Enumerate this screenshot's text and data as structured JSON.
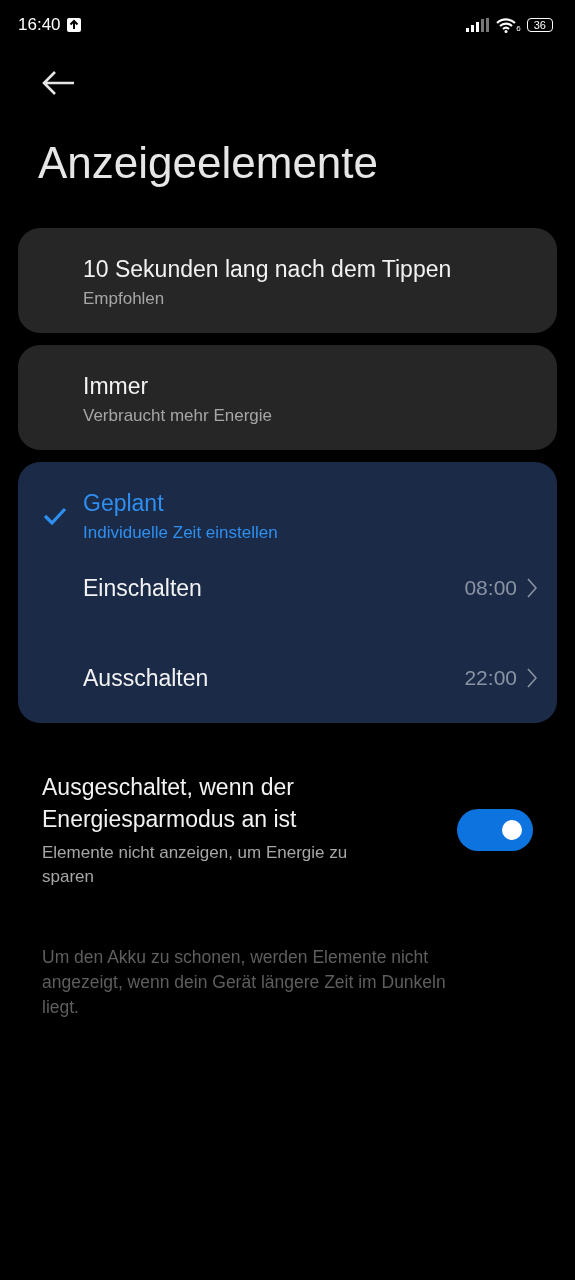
{
  "status_bar": {
    "time": "16:40",
    "wifi_badge": "6",
    "battery": "36"
  },
  "title": "Anzeigeelemente",
  "options": [
    {
      "title": "10 Sekunden lang nach dem Tippen",
      "subtitle": "Empfohlen",
      "selected": false
    },
    {
      "title": "Immer",
      "subtitle": "Verbraucht mehr Energie",
      "selected": false
    },
    {
      "title": "Geplant",
      "subtitle": "Individuelle Zeit einstellen",
      "selected": true,
      "schedule": [
        {
          "label": "Einschalten",
          "value": "08:00"
        },
        {
          "label": "Ausschalten",
          "value": "22:00"
        }
      ]
    }
  ],
  "power_saving": {
    "title": "Ausgeschaltet, wenn der Energiesparmodus an ist",
    "subtitle": "Elemente nicht anzeigen, um Energie zu sparen",
    "on": true
  },
  "footnote": "Um den Akku zu schonen, werden Elemente nicht angezeigt, wenn dein Gerät längere Zeit im Dunkeln liegt."
}
